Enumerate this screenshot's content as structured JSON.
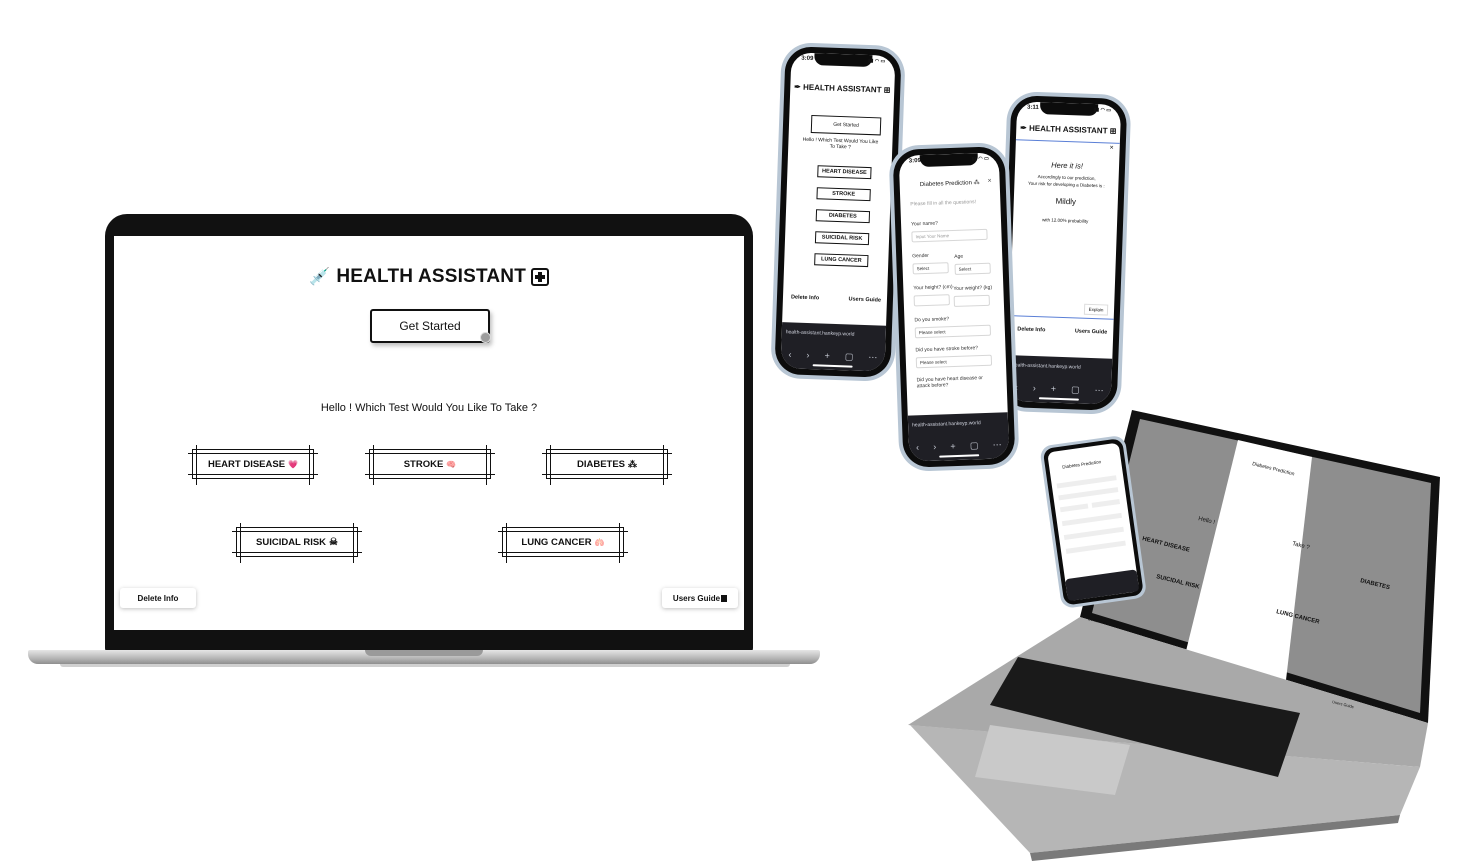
{
  "app": {
    "title": "HEALTH ASSISTANT",
    "get_started": "Get Started",
    "prompt": "Hello ! Which Test Would You Like To Take ?",
    "tests": [
      {
        "label": "HEART DISEASE",
        "icon": "heart-pulse-icon",
        "glyph": "💗"
      },
      {
        "label": "STROKE",
        "icon": "brain-icon",
        "glyph": "🧠"
      },
      {
        "label": "DIABETES",
        "icon": "drops-icon",
        "glyph": "⁂"
      },
      {
        "label": "SUICIDAL RISK",
        "icon": "skull-crossbones-icon",
        "glyph": "☠"
      },
      {
        "label": "LUNG CANCER",
        "icon": "lungs-icon",
        "glyph": "🫁"
      }
    ],
    "delete_info": "Delete Info",
    "users_guide": "Users Guide"
  },
  "phone1": {
    "time": "3:09",
    "title": "HEALTH ASSISTANT",
    "get_started": "Get Started",
    "prompt": "Hello ! Which Test Would You Like To Take ?",
    "tests": [
      "HEART DISEASE",
      "STROKE",
      "DIABETES",
      "SUICIDAL RISK",
      "LUNG CANCER"
    ],
    "delete_info": "Delete Info",
    "users_guide": "Users Guide",
    "url": "health-assistant.hankeyp.world"
  },
  "phone2": {
    "time": "3:09",
    "modal_title": "Diabetes Prediction",
    "instruction": "Please fill in all the questions!",
    "name_label": "Your name?",
    "name_placeholder": "Input Your Name",
    "gender_label": "Gender",
    "gender_value": "Select",
    "age_label": "Age",
    "age_value": "Select",
    "height_label": "Your height? (cm)",
    "weight_label": "Your weight? (kg)",
    "smoke_label": "Do you smoke?",
    "smoke_value": "Please select",
    "stroke_label": "Did you have stroke before?",
    "stroke_value": "Please select",
    "heart_label": "Did you have heart disease or attack before?",
    "url": "health-assistant.hankeyp.world"
  },
  "phone3": {
    "time": "3:11",
    "title": "HEALTH ASSISTANT",
    "result_title": "Here it is!",
    "result_line1": "Accordingly to our prediction,",
    "result_line2": "Your risk for developing a Diabetes is :",
    "risk": "Mildly",
    "probability": "with 12.00% probability",
    "explain": "Explain",
    "delete_info": "Delete Info",
    "users_guide": "Users Guide",
    "url": "health-assistant.hankeyp.world"
  },
  "tilted_laptop": {
    "modal_title": "Diabetes Prediction",
    "prompt_fragment": "Hello !",
    "prompt_fragment2": "Take ?",
    "tests": [
      "HEART DISEASE",
      "SUICIDAL RISK",
      "DIABETES",
      "LUNG CANCER"
    ],
    "delete_info": "Delete Info",
    "users_guide": "Users Guide"
  },
  "colors": {
    "ink": "#111111",
    "phone_frame": "#b8c6d4",
    "browser_bar": "#1f1f25",
    "overlay": "#8a8a8a"
  }
}
